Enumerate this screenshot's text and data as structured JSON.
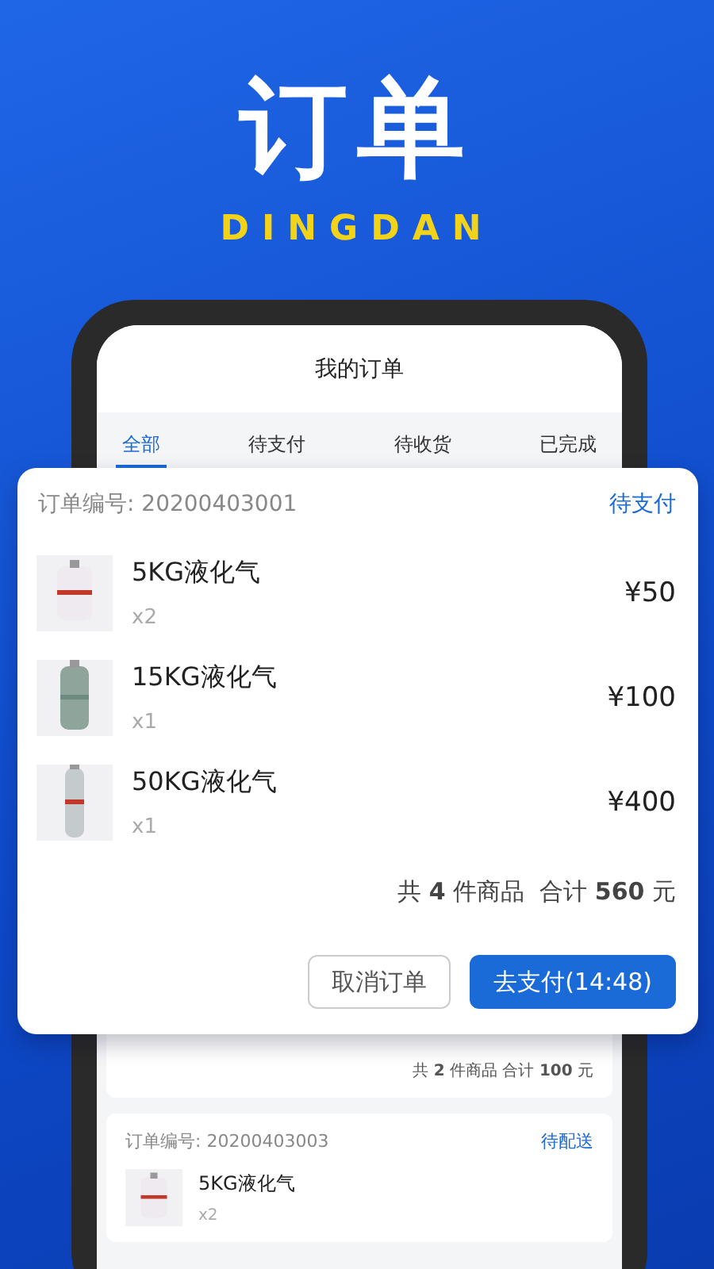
{
  "hero": {
    "title": "订单",
    "subtitle": "DINGDAN"
  },
  "screen": {
    "title": "我的订单",
    "tabs": [
      {
        "label": "全部",
        "selected": true
      },
      {
        "label": "待支付",
        "selected": false
      },
      {
        "label": "待收货",
        "selected": false
      },
      {
        "label": "已完成",
        "selected": false
      }
    ]
  },
  "featured_order": {
    "number_label": "订单编号: 20200403001",
    "status": "待支付",
    "items": [
      {
        "name": "5KG液化气",
        "quantity": "x2",
        "price": "¥50",
        "kind": "picture"
      },
      {
        "name": "15KG液化气",
        "quantity": "x1",
        "price": "¥100",
        "kind": "picture"
      },
      {
        "name": "50KG液化气",
        "quantity": "x1",
        "price": "¥400",
        "kind": "picture"
      }
    ],
    "summary": "共 **4** 件商品  合计 **560** 元",
    "buttons": [
      {
        "label": "取消订单",
        "kind": "secondary"
      },
      {
        "label": "去支付(14:48)",
        "kind": "primary"
      }
    ]
  },
  "orders": [
    {
      "summary": "共 **2** 件商品  合计 **100** 元"
    },
    {
      "number_label": "订单编号: 20200403003",
      "status": "待配送",
      "items": [
        {
          "name": "5KG液化气",
          "quantity": "x2",
          "kind": "picture"
        }
      ]
    }
  ]
}
